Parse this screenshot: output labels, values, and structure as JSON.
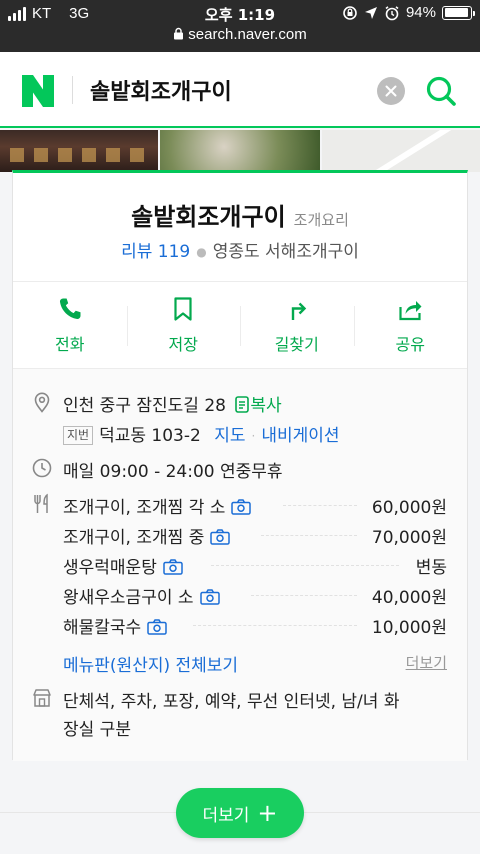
{
  "statusbar": {
    "carrier": "KT",
    "network": "3G",
    "time": "오후 1:19",
    "battery": "94%",
    "battery_level": 0.94,
    "url": "search.naver.com"
  },
  "header": {
    "query": "솔밭회조개구이"
  },
  "place": {
    "name": "솔밭회조개구이",
    "category": "조개요리",
    "review_label": "리뷰 119",
    "location_tag": "영종도 서해조개구이"
  },
  "actions": [
    {
      "label": "전화",
      "icon": "phone-icon"
    },
    {
      "label": "저장",
      "icon": "bookmark-icon"
    },
    {
      "label": "길찾기",
      "icon": "directions-icon"
    },
    {
      "label": "공유",
      "icon": "share-icon"
    }
  ],
  "address": {
    "road": "인천 중구 잠진도길 28",
    "copy_label": "복사",
    "lot_badge": "지번",
    "lot": "덕교동 103-2",
    "map_link": "지도",
    "navi_link": "내비게이션"
  },
  "hours": {
    "text": "매일 09:00 - 24:00 연중무휴"
  },
  "menu": {
    "items": [
      {
        "name": "조개구이, 조개찜 각 소",
        "price": "60,000원"
      },
      {
        "name": "조개구이, 조개찜 중",
        "price": "70,000원"
      },
      {
        "name": "생우럭매운탕",
        "price": "변동"
      },
      {
        "name": "왕새우소금구이 소",
        "price": "40,000원"
      },
      {
        "name": "해물칼국수",
        "price": "10,000원"
      }
    ],
    "full_link": "메뉴판(원산지) 전체보기",
    "more_link": "더보기"
  },
  "facilities": {
    "line1": "단체석, 주차, 포장, 예약, 무선 인터넷, 남/녀 화",
    "line2": "장실 구분"
  },
  "more_button": {
    "label": "더보기",
    "plus": "+"
  },
  "colors": {
    "brand_green": "#03c75a",
    "link_blue": "#1a6dd6"
  }
}
